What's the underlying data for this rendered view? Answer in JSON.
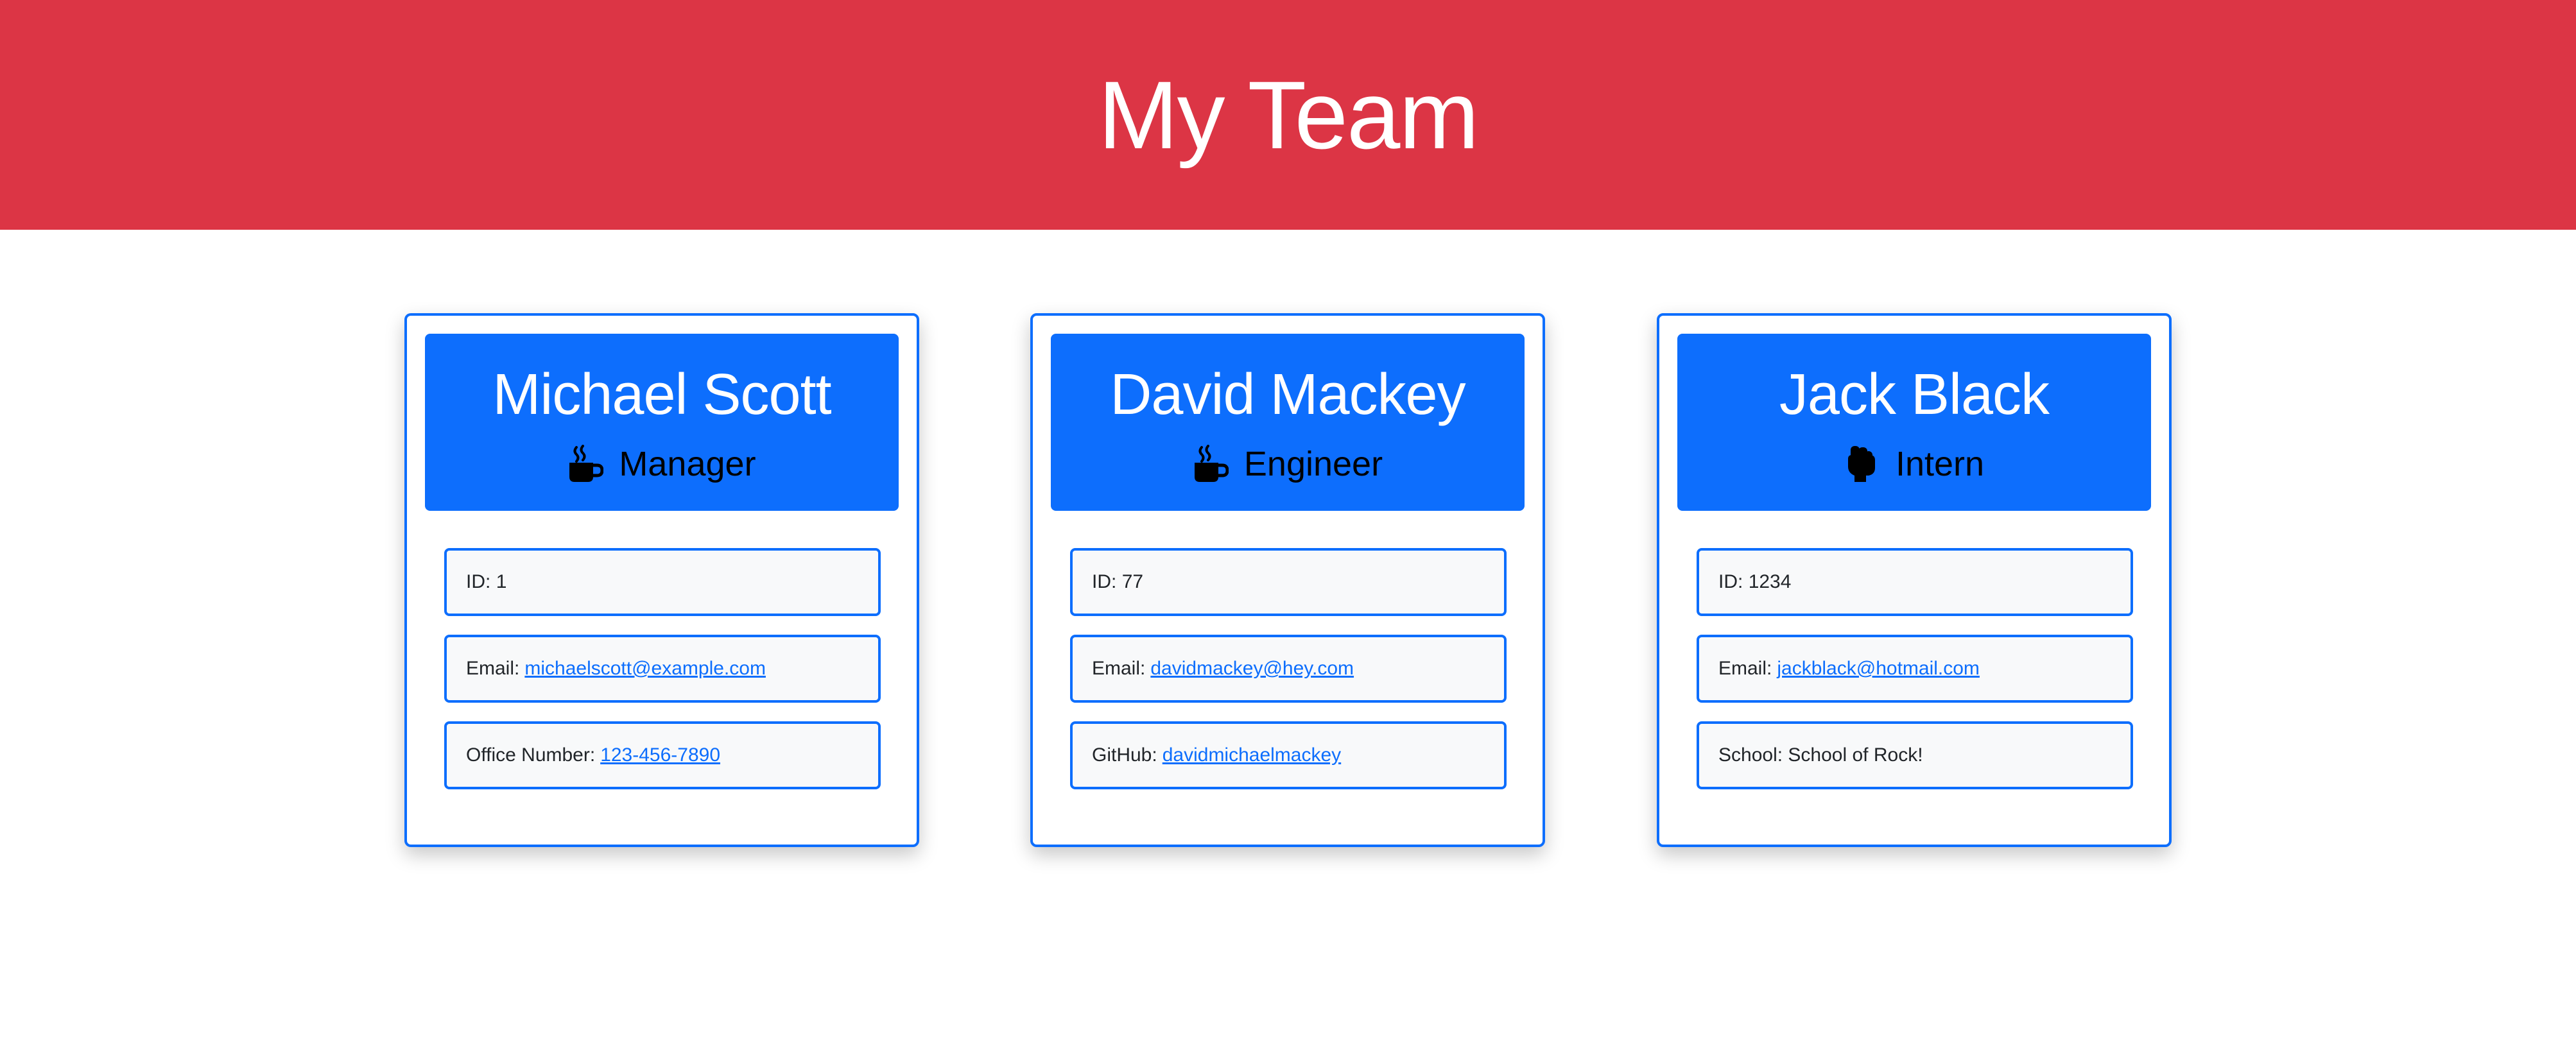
{
  "header": {
    "title": "My Team"
  },
  "colors": {
    "header_bg": "#dc3545",
    "accent": "#0d6efd",
    "item_bg": "#f8f9fa"
  },
  "team": [
    {
      "name": "Michael Scott",
      "role": "Manager",
      "role_icon": "coffee-mug-icon",
      "id_label": "ID:",
      "id": "1",
      "email_label": "Email:",
      "email": "michaelscott@example.com",
      "extra_label": "Office Number:",
      "extra_value": "123-456-7890"
    },
    {
      "name": "David Mackey",
      "role": "Engineer",
      "role_icon": "coffee-mug-icon",
      "id_label": "ID:",
      "id": "77",
      "email_label": "Email:",
      "email": "davidmackey@hey.com",
      "extra_label": "GitHub:",
      "extra_value": "davidmichaelmackey"
    },
    {
      "name": "Jack Black",
      "role": "Intern",
      "role_icon": "hand-icon",
      "id_label": "ID:",
      "id": "1234",
      "email_label": "Email:",
      "email": "jackblack@hotmail.com",
      "extra_label": "School:",
      "extra_value": "School of Rock!"
    }
  ]
}
